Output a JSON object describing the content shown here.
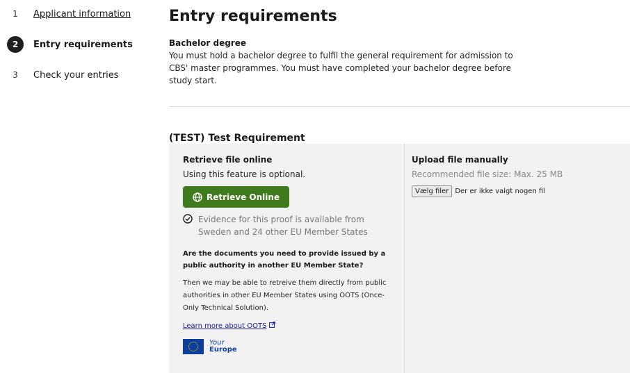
{
  "steps": [
    {
      "num": "1",
      "label": "Applicant information"
    },
    {
      "num": "2",
      "label": "Entry requirements"
    },
    {
      "num": "3",
      "label": "Check your entries"
    }
  ],
  "main": {
    "title": "Entry requirements",
    "requirement_title": "Bachelor degree",
    "requirement_text": "You must hold a bachelor degree to fulfil the general requirement for admission to CBS' master programmes. You must have completed your bachelor degree before study start.",
    "section_title": "(TEST) Test Requirement"
  },
  "retrieve": {
    "heading": "Retrieve file online",
    "optional": "Using this feature is optional.",
    "button": "Retrieve Online",
    "evidence": "Evidence for this proof is available from Sweden and 24 other EU Member States",
    "question": "Are the documents you need to provide issued by a public authority in another EU Member State?",
    "answer": "Then we may be able to retreive them directly from public authorities in other EU Member States using OOTS (Once-Only Technical Solution).",
    "learn_more": "Learn more about OOTS",
    "logo_top": "Your",
    "logo_bottom": "Europe"
  },
  "upload": {
    "heading": "Upload file manually",
    "hint": "Recommended file size: Max. 25 MB",
    "choose_button": "Vælg filer",
    "no_file": "Der er ikke valgt nogen fil"
  },
  "colors": {
    "accent_green": "#3f7a1c",
    "panel_bg": "#f2f2f2"
  }
}
